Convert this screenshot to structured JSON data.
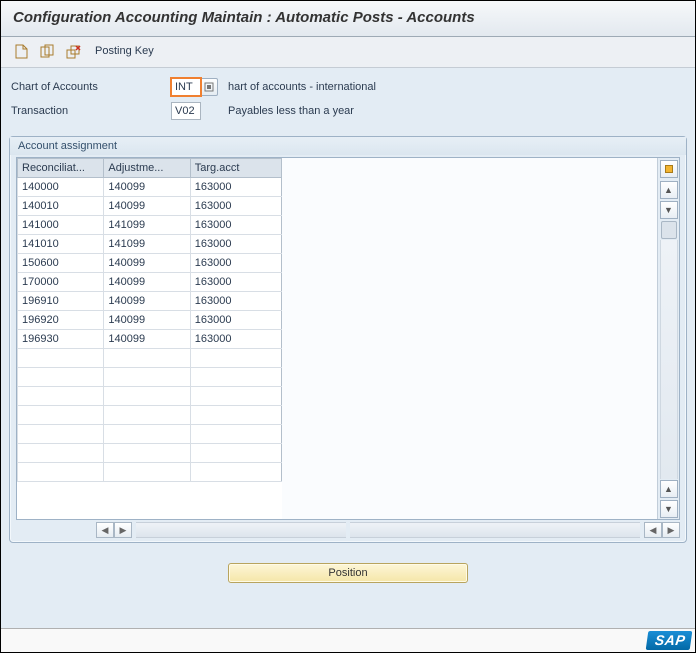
{
  "title": "Configuration Accounting Maintain : Automatic Posts - Accounts",
  "toolbar": {
    "posting_key_label": "Posting Key",
    "icons": {
      "new": "new-document-icon",
      "copy": "copy-icon",
      "delete": "delete-icon"
    }
  },
  "fields": {
    "chart_of_accounts": {
      "label": "Chart of Accounts",
      "value": "INT",
      "help_text": "hart of accounts - international"
    },
    "transaction": {
      "label": "Transaction",
      "value": "V02",
      "description": "Payables less than a year"
    }
  },
  "panel": {
    "title": "Account assignment"
  },
  "table": {
    "headers": [
      "Reconciliat...",
      "Adjustme...",
      "Targ.acct"
    ],
    "rows": [
      [
        "140000",
        "140099",
        "163000"
      ],
      [
        "140010",
        "140099",
        "163000"
      ],
      [
        "141000",
        "141099",
        "163000"
      ],
      [
        "141010",
        "141099",
        "163000"
      ],
      [
        "150600",
        "140099",
        "163000"
      ],
      [
        "170000",
        "140099",
        "163000"
      ],
      [
        "196910",
        "140099",
        "163000"
      ],
      [
        "196920",
        "140099",
        "163000"
      ],
      [
        "196930",
        "140099",
        "163000"
      ],
      [
        "",
        "",
        ""
      ],
      [
        "",
        "",
        ""
      ],
      [
        "",
        "",
        ""
      ],
      [
        "",
        "",
        ""
      ],
      [
        "",
        "",
        ""
      ],
      [
        "",
        "",
        ""
      ],
      [
        "",
        "",
        ""
      ]
    ]
  },
  "buttons": {
    "position": "Position"
  },
  "brand": "SAP"
}
